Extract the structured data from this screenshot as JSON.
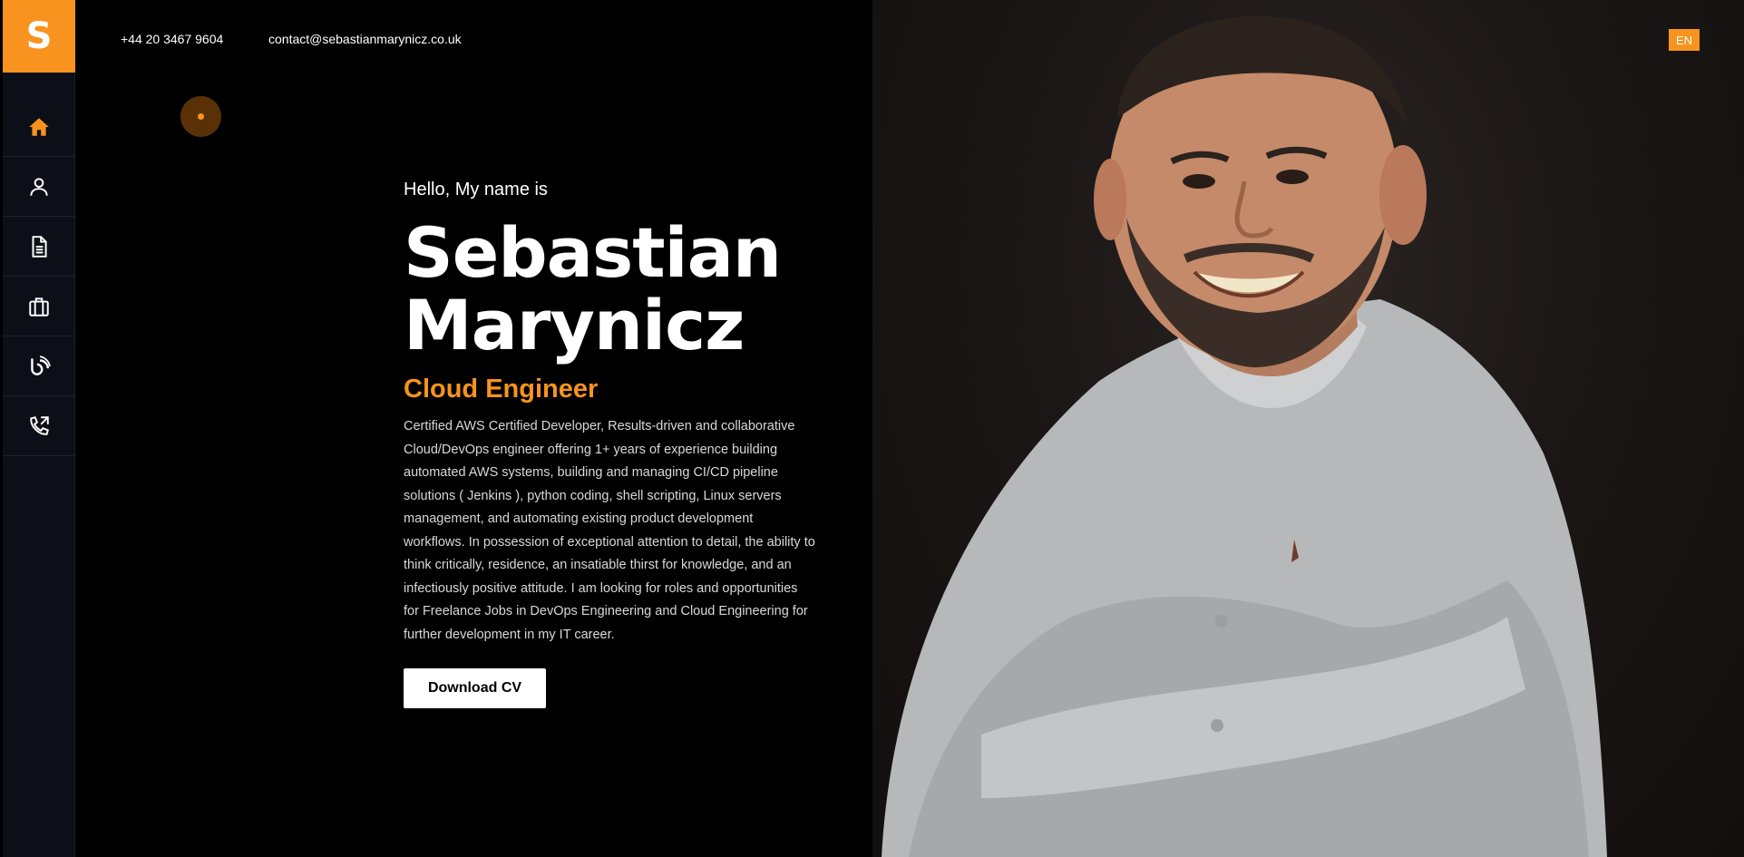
{
  "brand": {
    "logo_letter": "S",
    "accent_color": "#f7931e"
  },
  "topbar": {
    "phone": "+44 20 3467 9604",
    "email": "contact@sebastianmarynicz.co.uk",
    "language": "EN"
  },
  "sidebar": {
    "items": [
      {
        "icon": "home-icon",
        "active": true
      },
      {
        "icon": "user-icon",
        "active": false
      },
      {
        "icon": "document-icon",
        "active": false
      },
      {
        "icon": "briefcase-icon",
        "active": false
      },
      {
        "icon": "blog-icon",
        "active": false
      },
      {
        "icon": "phone-icon",
        "active": false
      }
    ]
  },
  "hero": {
    "greeting": "Hello, My name is",
    "first_name": "Sebastian",
    "last_name": "Marynicz",
    "role": "Cloud Engineer",
    "bio": "Certified AWS Certified Developer, Results-driven and collaborative Cloud/DevOps engineer offering 1+ years of experience building automated AWS systems, building and managing CI/CD pipeline solutions ( Jenkins ), python coding, shell scripting, Linux servers management, and automating existing product development workflows. In possession of exceptional attention to detail, the ability to think critically, residence, an insatiable thirst for knowledge, and an infectiously positive attitude. I am looking for roles and opportunities for Freelance Jobs in DevOps Engineering and Cloud Engineering for further development in my IT career.",
    "cta_label": "Download CV"
  }
}
